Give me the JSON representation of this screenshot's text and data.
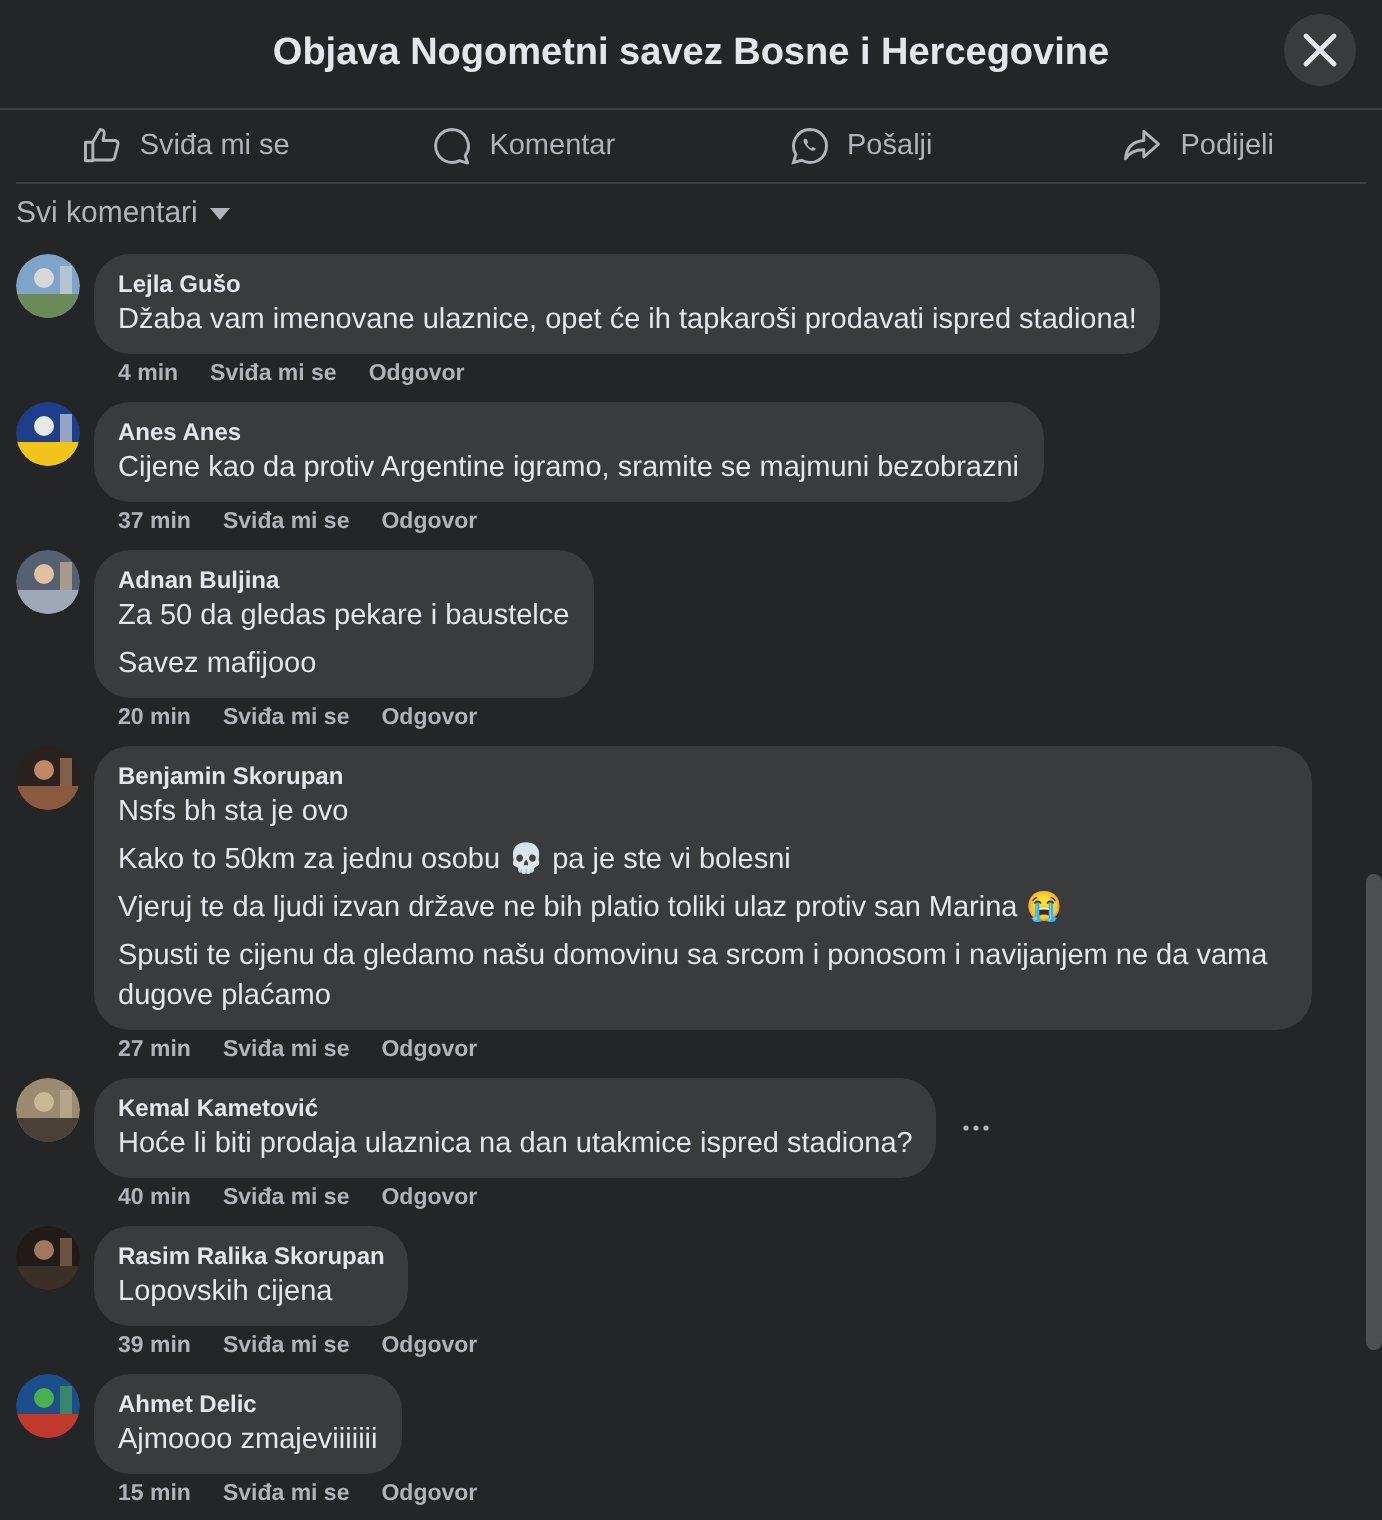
{
  "window": {
    "title": "Objava Nogometni savez Bosne i Hercegovine"
  },
  "actions": [
    {
      "kind": "like",
      "label": "Sviđa mi se"
    },
    {
      "kind": "comment",
      "label": "Komentar"
    },
    {
      "kind": "whatsapp",
      "label": "Pošalji"
    },
    {
      "kind": "share",
      "label": "Podijeli"
    }
  ],
  "filter": {
    "label": "Svi komentari"
  },
  "comments": [
    {
      "author": "Lejla Gušo",
      "paragraphs": [
        "Džaba vam imenovane ulaznice, opet će ih tapkaroši prodavati ispred stadiona!"
      ],
      "time": "4 min",
      "like": "Sviđa mi se",
      "reply": "Odgovor",
      "hovered": false
    },
    {
      "author": "Anes Anes",
      "paragraphs": [
        "Cijene kao da protiv Argentine igramo, sramite se majmuni bezobrazni"
      ],
      "time": "37 min",
      "like": "Sviđa mi se",
      "reply": "Odgovor",
      "hovered": false
    },
    {
      "author": "Adnan Buljina",
      "paragraphs": [
        "Za 50 da gledas pekare i baustelce",
        "Savez mafijooo"
      ],
      "time": "20 min",
      "like": "Sviđa mi se",
      "reply": "Odgovor",
      "hovered": false
    },
    {
      "author": "Benjamin Skorupan",
      "paragraphs": [
        "Nsfs bh sta je ovo",
        "Kako to 50km za jednu osobu 💀 pa je ste vi bolesni",
        "Vjeruj te da ljudi izvan države ne bih platio toliki ulaz protiv san Marina 😭",
        "Spusti te cijenu da gledamo našu domovinu sa srcom i ponosom i navijanjem ne da vama dugove plaćamo"
      ],
      "time": "27 min",
      "like": "Sviđa mi se",
      "reply": "Odgovor",
      "hovered": false
    },
    {
      "author": "Kemal Kametović",
      "paragraphs": [
        "Hoće li biti prodaja ulaznica na dan utakmice ispred stadiona?"
      ],
      "time": "40 min",
      "like": "Sviđa mi se",
      "reply": "Odgovor",
      "hovered": true
    },
    {
      "author": "Rasim Ralika Skorupan",
      "paragraphs": [
        "Lopovskih cijena"
      ],
      "time": "39 min",
      "like": "Sviđa mi se",
      "reply": "Odgovor",
      "hovered": false
    },
    {
      "author": "Ahmet Delic",
      "paragraphs": [
        "Ajmoooo zmajeviiiiiii"
      ],
      "time": "15 min",
      "like": "Sviđa mi se",
      "reply": "Odgovor",
      "hovered": false
    }
  ]
}
